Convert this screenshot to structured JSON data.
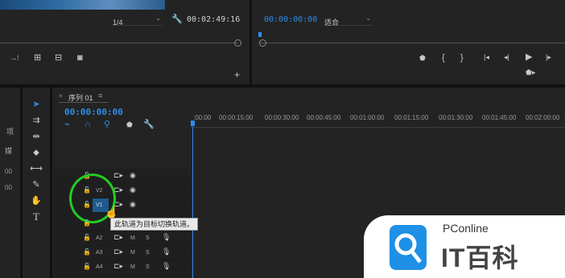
{
  "source_monitor": {
    "zoom": "1/4",
    "timecode": "00:02:49:16"
  },
  "program_monitor": {
    "timecode": "00:00:00:00",
    "fit": "适合"
  },
  "left_panel": {
    "frag1": "项",
    "frag2": "媒",
    "frag3": "00",
    "frag4": "00"
  },
  "sequence": {
    "tab_label": "序列 01",
    "timecode": "00:00:00:00"
  },
  "ruler": [
    ":00:00",
    "00:00:15:00",
    "00:00:30:00",
    "00:00:45:00",
    "00:01:00:00",
    "00:01:15:00",
    "00:01:30:00",
    "00:01:45:00",
    "00:02:00:00"
  ],
  "tracks": {
    "video": [
      {
        "label": "V2"
      },
      {
        "label": "V1"
      }
    ],
    "audio": [
      {
        "label": "A2"
      },
      {
        "label": "A3"
      },
      {
        "label": "A4"
      }
    ],
    "mute": "M",
    "solo": "S"
  },
  "tooltip": "此轨道为目标切换轨道。",
  "watermark": {
    "brand_small": "PConline",
    "brand_large": "IT百科"
  },
  "colors": {
    "accent_blue": "#2d8ceb",
    "highlight_green": "#22cc22",
    "panel_bg": "#232323"
  }
}
